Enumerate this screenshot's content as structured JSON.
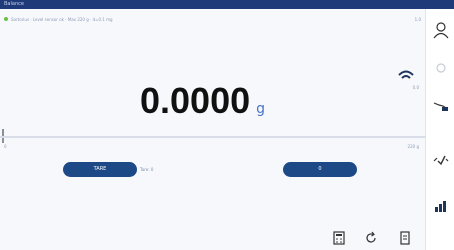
{
  "window": {
    "title": "Balance"
  },
  "status": {
    "text": "Sartorius · Level sensor ok · Max 220 g · d=0.1 mg",
    "right": "1.0"
  },
  "display": {
    "weight": "0.0000",
    "unit": "g",
    "side_value": "0.0",
    "min_label": "0",
    "max_label": "220 g"
  },
  "actions": {
    "tare_label": "TARE",
    "tare_info": "Tare: 0",
    "zero_label": "0"
  },
  "bottom_toolbar": {
    "icons": [
      "calculator-icon",
      "refresh-icon",
      "print-icon"
    ]
  },
  "sidebar": {
    "icons": [
      "user-icon",
      "settings-icon",
      "weighing-icon",
      "check-icon",
      "statistics-icon"
    ]
  },
  "colors": {
    "accent": "#1d4a86",
    "titlebar": "#1f3a78",
    "unit": "#4a74c8"
  }
}
